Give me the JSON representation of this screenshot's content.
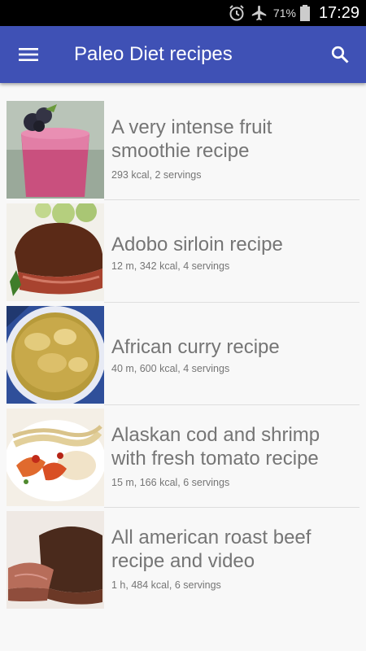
{
  "status": {
    "battery": "71%",
    "time": "17:29"
  },
  "app_bar": {
    "title": "Paleo Diet recipes"
  },
  "recipes": [
    {
      "title": "A very intense fruit smoothie recipe",
      "meta": "293 kcal, 2 servings"
    },
    {
      "title": "Adobo sirloin recipe",
      "meta": "12 m, 342 kcal, 4 servings"
    },
    {
      "title": "African curry recipe",
      "meta": "40 m, 600 kcal, 4 servings"
    },
    {
      "title": "Alaskan cod and shrimp with fresh tomato recipe",
      "meta": "15 m, 166 kcal, 6 servings"
    },
    {
      "title": "All american roast beef recipe and video",
      "meta": "1 h, 484 kcal, 6 servings"
    }
  ],
  "colors": {
    "app_bar": "#3f51b5",
    "text": "#757575",
    "background": "#f8f8f8"
  }
}
